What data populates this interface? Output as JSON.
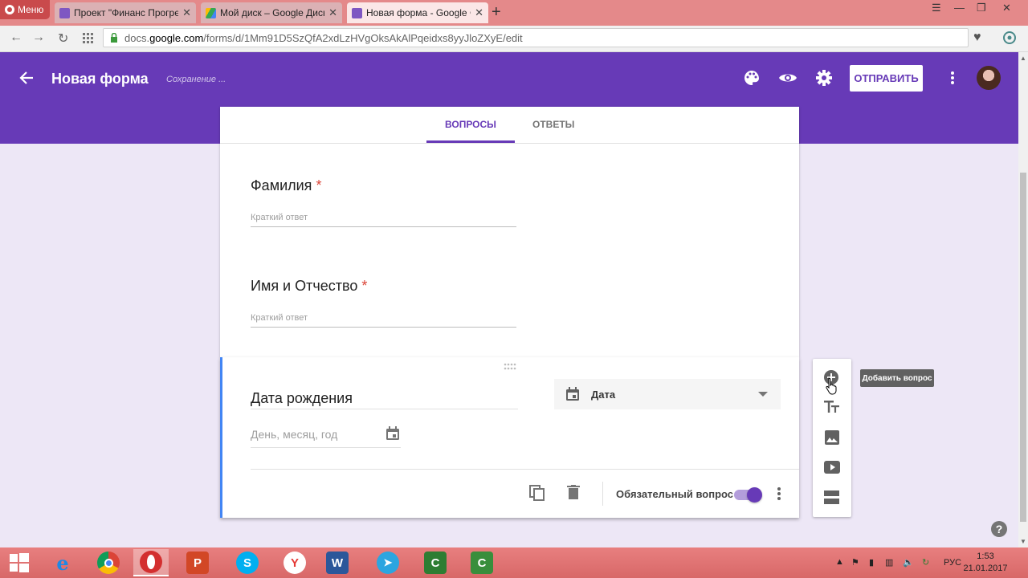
{
  "browser": {
    "menu_label": "Меню",
    "tabs": [
      {
        "title": "Проект \"Финанс Прогрес",
        "favicon": "forms-icon",
        "active": false
      },
      {
        "title": "Мой диск – Google Диск",
        "favicon": "drive-icon",
        "active": false
      },
      {
        "title": "Новая форма - Google Ф",
        "favicon": "forms-icon",
        "active": true
      }
    ],
    "url_prefix": "docs.",
    "url_domain": "google.com",
    "url_path": "/forms/d/1Mm91D5SzQfA2xdLzHVgOksAkAlPqeidxs8yyJloZXyE/edit"
  },
  "forms_header": {
    "title": "Новая форма",
    "saving_status": "Сохранение ...",
    "send_label": "ОТПРАВИТЬ",
    "accent_color": "#673ab7"
  },
  "tabs": {
    "questions": "ВОПРОСЫ",
    "responses": "ОТВЕТЫ"
  },
  "questions": [
    {
      "title": "Фамилия",
      "required_mark": "*",
      "placeholder": "Краткий ответ"
    },
    {
      "title": "Имя и Отчество",
      "required_mark": "*",
      "placeholder": "Краткий ответ"
    }
  ],
  "active_question": {
    "title": "Дата рождения",
    "answer_placeholder": "День, месяц, год",
    "type_label": "Дата",
    "required_label": "Обязательный вопрос",
    "required_on": true
  },
  "side_toolbar": {
    "tooltip": "Добавить вопрос"
  },
  "taskbar": {
    "language": "РУС",
    "time": "1:53",
    "date": "21.01.2017"
  }
}
